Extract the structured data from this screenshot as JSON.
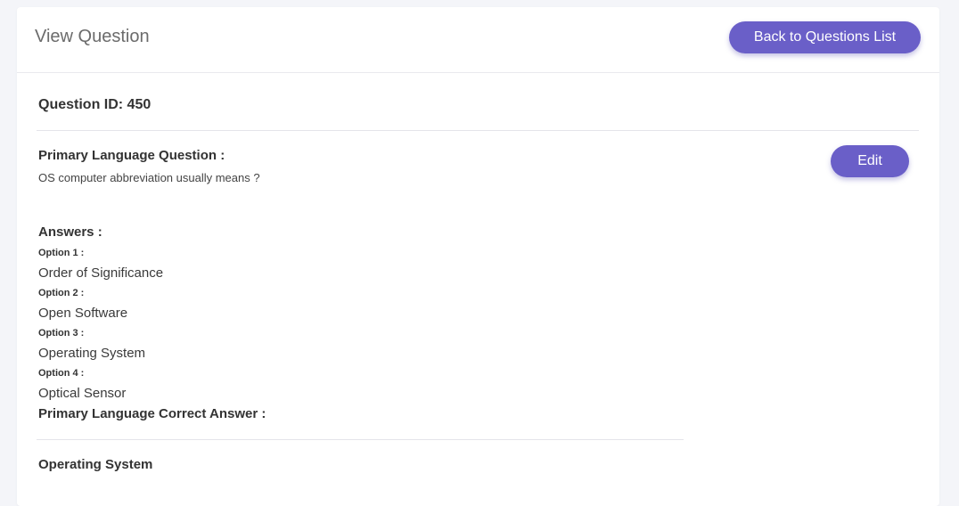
{
  "header": {
    "title": "View Question",
    "back_button_label": "Back to Questions List"
  },
  "question": {
    "id_text": "Question ID: 450",
    "primary_label": "Primary Language Question :",
    "primary_text": "OS computer abbreviation usually means ?",
    "edit_label": "Edit"
  },
  "answers": {
    "label": "Answers :",
    "options": [
      {
        "label": "Option 1 :",
        "text": "Order of Significance"
      },
      {
        "label": "Option 2 :",
        "text": "Open Software"
      },
      {
        "label": "Option 3 :",
        "text": "Operating System"
      },
      {
        "label": "Option 4 :",
        "text": "Optical Sensor"
      }
    ]
  },
  "correct_answer": {
    "label": "Primary Language Correct Answer :",
    "value": "Operating System"
  },
  "colors": {
    "accent": "#6a5fc8",
    "background": "#f4f5f9",
    "card": "#ffffff"
  }
}
